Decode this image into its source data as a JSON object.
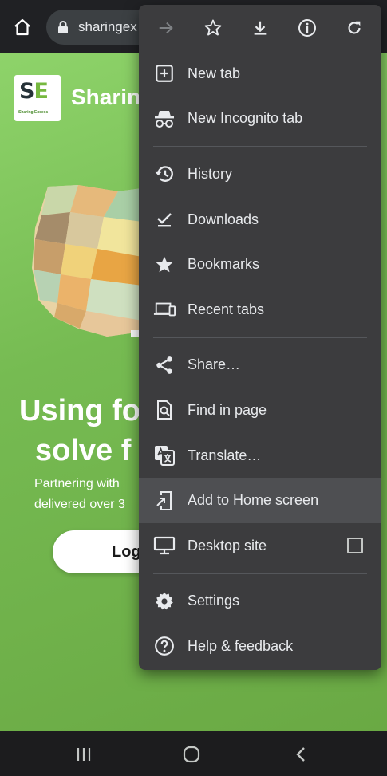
{
  "browser": {
    "url": "sharingex",
    "icons": {
      "home": "home-icon",
      "lock": "lock-icon"
    }
  },
  "page": {
    "logo": {
      "initials_s": "S",
      "initials_e": "E",
      "subtitle": "Sharing Excess"
    },
    "site_name": "Sharin",
    "hero_line1": "Using fo",
    "hero_line2": "solve f",
    "sub_line1": "Partnering with",
    "sub_line2": "delivered over 3",
    "login_label": "Log"
  },
  "menu": {
    "top_icons": [
      "forward-icon",
      "star-icon",
      "download-icon",
      "info-icon",
      "refresh-icon"
    ],
    "items": [
      {
        "label": "New tab",
        "icon": "new-tab-icon"
      },
      {
        "label": "New Incognito tab",
        "icon": "incognito-icon"
      },
      {
        "label": "History",
        "icon": "history-icon"
      },
      {
        "label": "Downloads",
        "icon": "downloads-icon"
      },
      {
        "label": "Bookmarks",
        "icon": "bookmarks-icon"
      },
      {
        "label": "Recent tabs",
        "icon": "recent-tabs-icon"
      },
      {
        "label": "Share…",
        "icon": "share-icon"
      },
      {
        "label": "Find in page",
        "icon": "find-in-page-icon"
      },
      {
        "label": "Translate…",
        "icon": "translate-icon"
      },
      {
        "label": "Add to Home screen",
        "icon": "add-to-home-icon",
        "highlighted": true
      },
      {
        "label": "Desktop site",
        "icon": "desktop-icon",
        "checkbox_checked": false
      },
      {
        "label": "Settings",
        "icon": "settings-icon"
      },
      {
        "label": "Help & feedback",
        "icon": "help-icon"
      }
    ]
  },
  "navbar": {
    "icons": [
      "recents-icon",
      "home-circle-icon",
      "back-icon"
    ]
  },
  "colors": {
    "toolbar": "#202124",
    "menu_bg": "#3c3c3e",
    "menu_highlight": "#4e4f52",
    "page_green": "#76bb52",
    "text": "#e8eaed"
  }
}
